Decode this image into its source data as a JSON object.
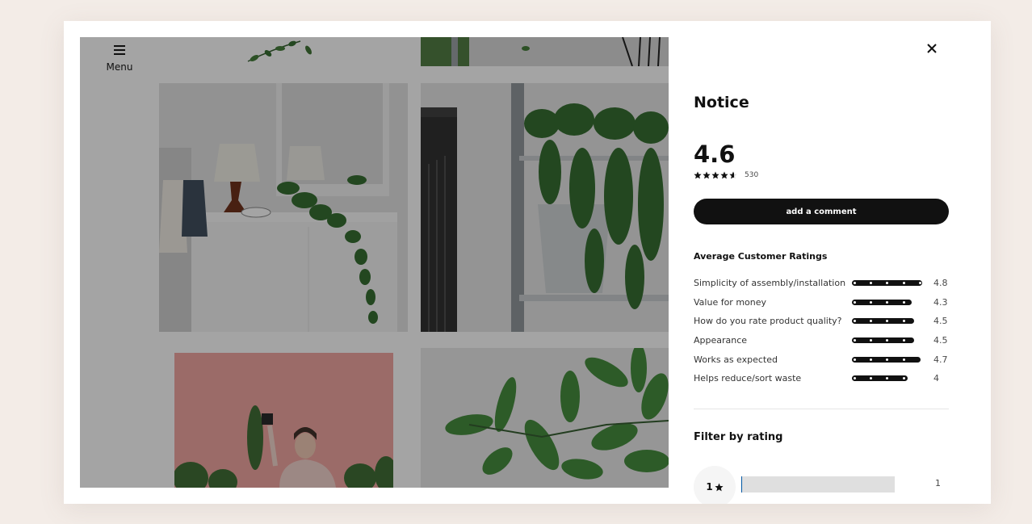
{
  "menu": {
    "label": "Menu",
    "icon": "hamburger-icon"
  },
  "panel": {
    "title": "Notice",
    "close_icon": "close-icon",
    "overall_rating": "4.6",
    "overall_rating_value": 4.6,
    "review_count": "530",
    "add_comment_label": "add a comment",
    "average_ratings_title": "Average Customer Ratings",
    "average_ratings": [
      {
        "label": "Simplicity of assembly/installation",
        "value": "4.8",
        "score": 4.8
      },
      {
        "label": "Value for money",
        "value": "4.3",
        "score": 4.3
      },
      {
        "label": "How do you rate product quality?",
        "value": "4.5",
        "score": 4.5
      },
      {
        "label": "Appearance",
        "value": "4.5",
        "score": 4.5
      },
      {
        "label": "Works as expected",
        "value": "4.7",
        "score": 4.7
      },
      {
        "label": "Helps reduce/sort waste",
        "value": "4",
        "score": 4
      }
    ],
    "filter_title": "Filter by rating",
    "filters": [
      {
        "stars": "1",
        "count": "1",
        "fraction": 0.002
      }
    ]
  },
  "gallery": {
    "tiles": [
      {
        "name": "leaves-top-left",
        "description": "trailing plant leaves"
      },
      {
        "name": "balcony-top-right",
        "description": "balcony railing with plants"
      },
      {
        "name": "dresser-plant",
        "description": "white dresser with lamp and hanging plant"
      },
      {
        "name": "shelf-plants",
        "description": "metal shelf with hanging plants in pots"
      },
      {
        "name": "woman-pink",
        "description": "woman holding plant on pink background"
      },
      {
        "name": "green-leaves",
        "description": "close-up of green plant leaves"
      }
    ]
  },
  "colors": {
    "page_bg": "#f3ece7",
    "accent": "#111111",
    "button_text": "#ffffff"
  }
}
